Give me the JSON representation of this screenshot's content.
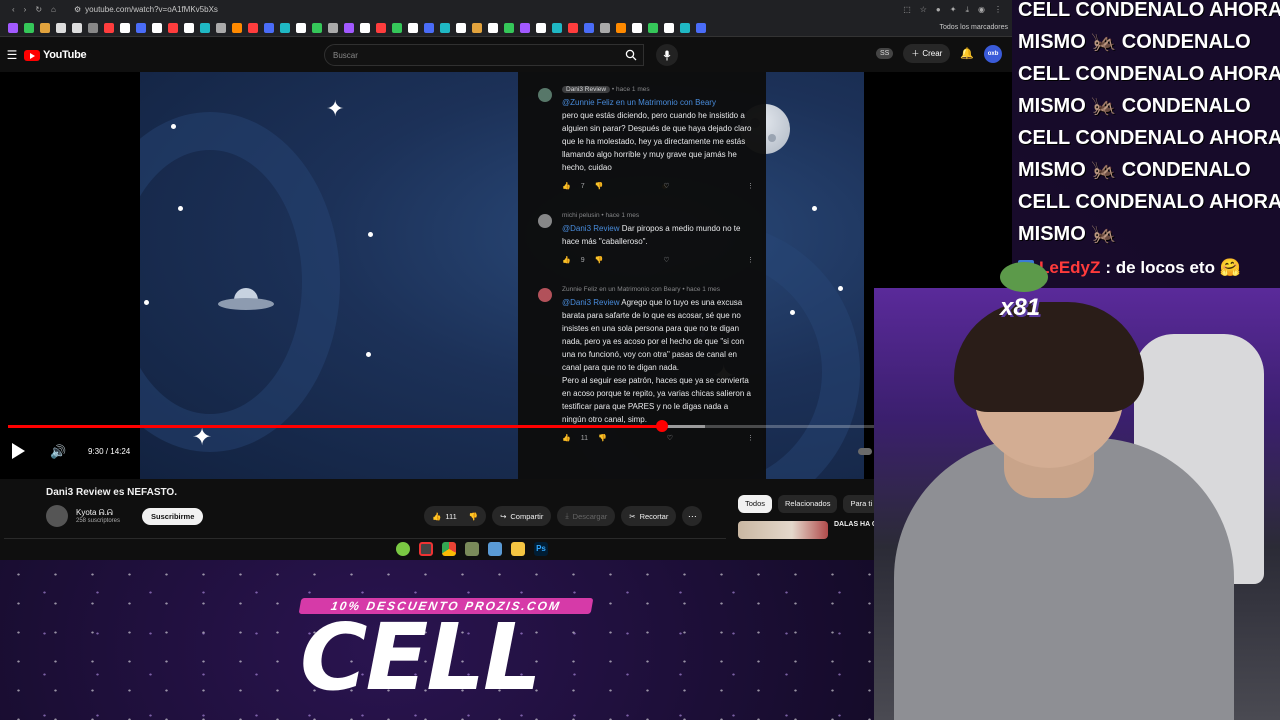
{
  "browser": {
    "url": "youtube.com/watch?v=oA1fMKv5bXs",
    "bookmarks_label": "Todos los marcadores"
  },
  "youtube": {
    "logo_text": "YouTube",
    "search_placeholder": "Buscar",
    "ss_badge": "SS",
    "create_label": "Crear",
    "avatar_text": "oxb"
  },
  "comments": [
    {
      "author": "Dani3 Review",
      "time": "• hace 1 mes",
      "mention": "@Zunnie Feliz en un Matrimonio con Beary",
      "text": "pero que estás diciendo, pero cuando he insistido a alguien sin parar? Después de que haya dejado claro que le ha molestado, hey ya directamente me estás llamando algo horrible y muy grave que jamás he hecho, cuidao",
      "likes": "7"
    },
    {
      "author": "michi pelusin",
      "time": "• hace 1 mes",
      "mention": "@Dani3 Review",
      "text": "Dar piropos a medio mundo no te hace más \"caballeroso\".",
      "likes": "9"
    },
    {
      "author": "Zunnie Feliz en un Matrimonio con Beary",
      "time": "• hace 1 mes",
      "mention": "@Dani3 Review",
      "text": "Agrego que lo tuyo es una excusa barata para safarte de lo que es acosar, sé que no insistes en una sola persona para que no te digan nada, pero ya es acoso por el hecho de que \"si con una no funcionó, voy con otra\" pasas de canal en canal para que no te digan nada.",
      "text2": "Pero al seguir ese patrón, haces que ya se convierta en acoso porque te repito, ya varias chicas salieron a testificar para que PARES y no le digas nada a ningún otro canal, simp.",
      "likes": "11"
    }
  ],
  "player": {
    "time": "9:30 / 14:24",
    "progress": 0.657,
    "buffered": 0.7
  },
  "video": {
    "title": "Dani3 Review es NEFASTO.",
    "channel": "Kyota ᕱ.ᕱ",
    "subs": "258 suscriptores",
    "subscribe": "Suscribirme",
    "likes": "111",
    "share": "Compartir",
    "download": "Descargar",
    "clip": "Recortar"
  },
  "chips": [
    "Todos",
    "Relacionados",
    "Para ti"
  ],
  "reco_title": "DALAS HA C",
  "promo_text": "10% DESCUENTO PROZIS.COM",
  "big_text": "CELL",
  "chat": {
    "lines": [
      "CELL CONDENALO AHORA",
      "MISMO 🦗 CONDENALO",
      "CELL CONDENALO AHORA",
      "MISMO 🦗 CONDENALO",
      "CELL CONDENALO AHORA",
      "MISMO 🦗 CONDENALO",
      "CELL CONDENALO AHORA",
      "MISMO 🦗"
    ],
    "user": "LeEdyZ",
    "message": ": de locos eto 🤗"
  },
  "gift_count": "x81",
  "colors": {
    "accent": "#ff0000",
    "promo": "#d63aa8",
    "chat_user": "#ff3b3b",
    "link": "#4a8fe0"
  }
}
